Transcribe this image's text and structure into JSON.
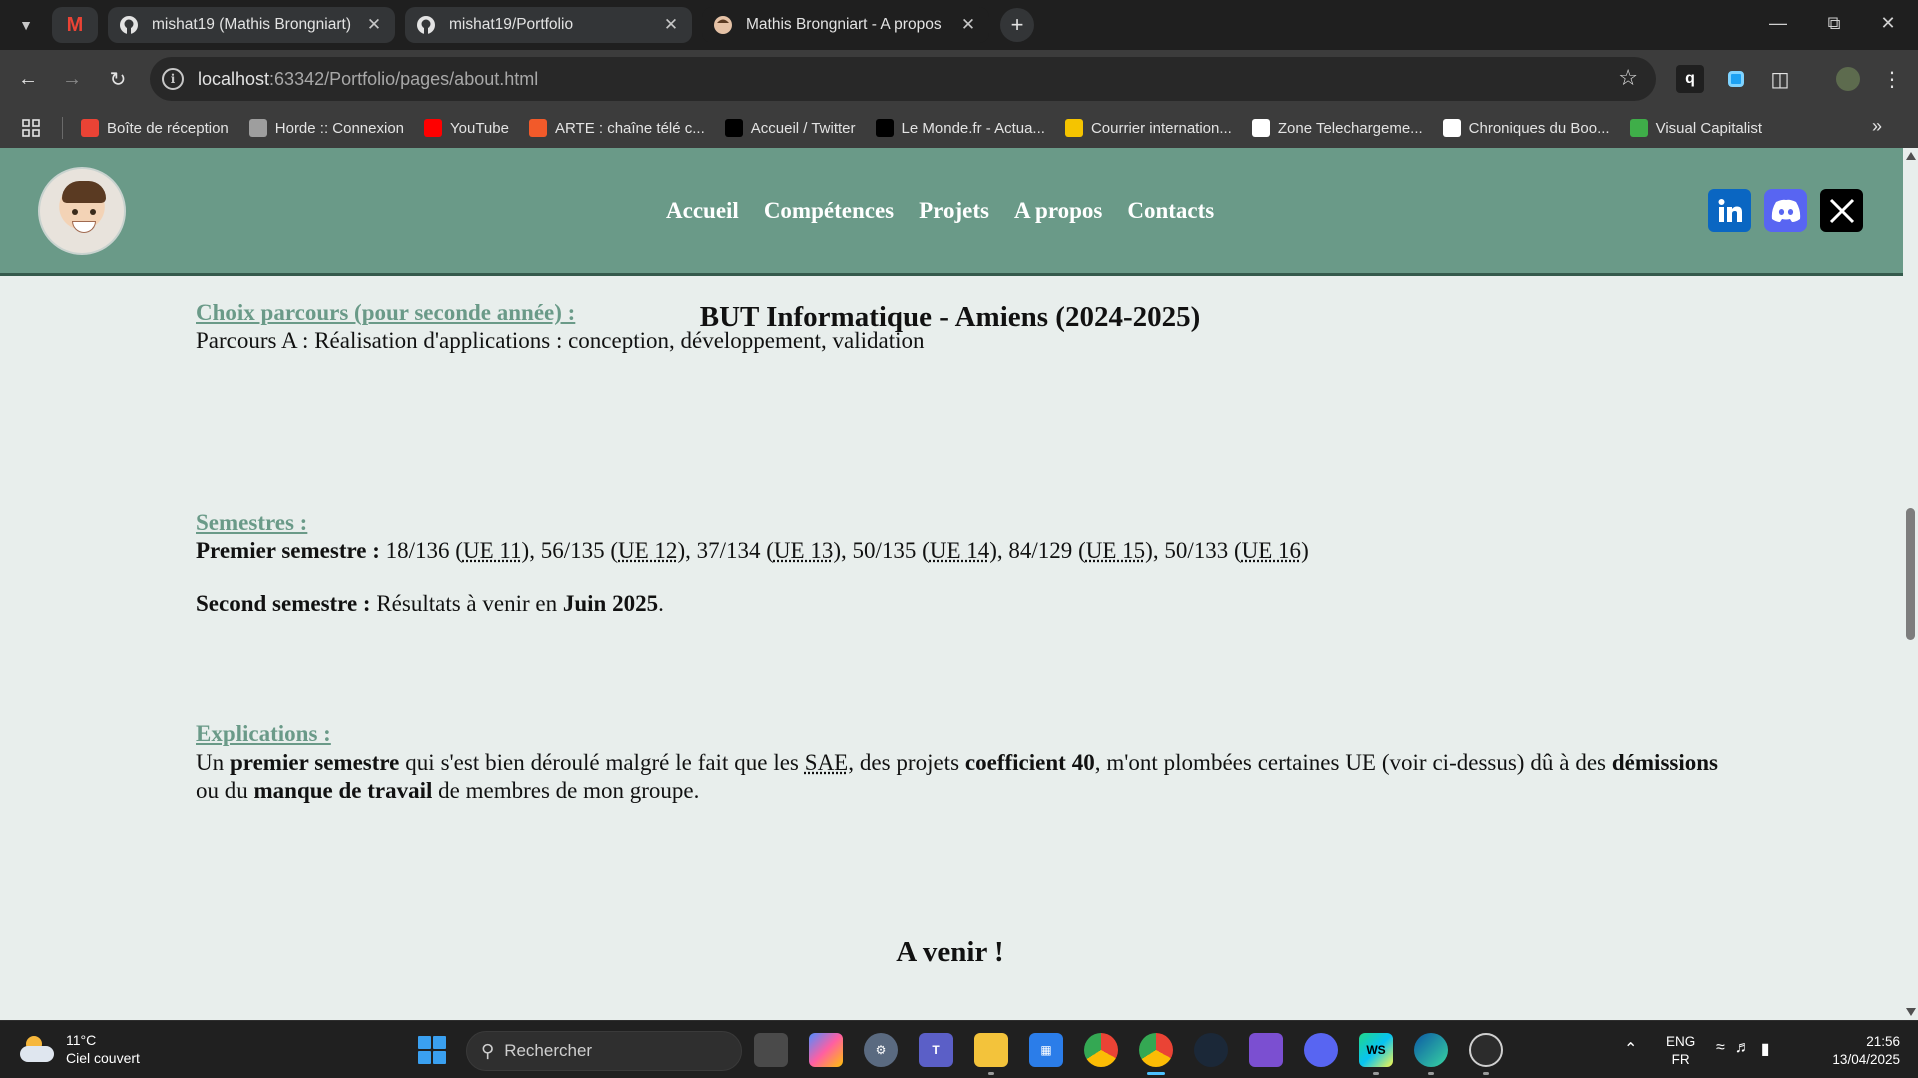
{
  "browser": {
    "tabs": [
      {
        "title": "mishat19 (Mathis Brongniart)",
        "icon": "github-icon"
      },
      {
        "title": "mishat19/Portfolio",
        "icon": "github-icon"
      },
      {
        "title": "Mathis Brongniart - A propos",
        "icon": "avatar-favicon",
        "active": true
      }
    ],
    "url_host": "localhost",
    "url_rest": ":63342/Portfolio/pages/about.html",
    "bookmarks": [
      {
        "label": "Boîte de réception",
        "icon": "gmail-icon",
        "color": "#ea4335"
      },
      {
        "label": "Horde :: Connexion",
        "icon": "horde-icon",
        "color": "#9e9e9e"
      },
      {
        "label": "YouTube",
        "icon": "youtube-icon",
        "color": "#ff0000"
      },
      {
        "label": "ARTE : chaîne télé c...",
        "icon": "arte-icon",
        "color": "#f25a2a"
      },
      {
        "label": "Accueil / Twitter",
        "icon": "x-icon",
        "color": "#000000"
      },
      {
        "label": "Le Monde.fr - Actua...",
        "icon": "lemonde-icon",
        "color": "#000000"
      },
      {
        "label": "Courrier internation...",
        "icon": "courrier-icon",
        "color": "#f5c400"
      },
      {
        "label": "Zone Telechargeme...",
        "icon": "zt-icon",
        "color": "#ffffff"
      },
      {
        "label": "Chroniques du Boo...",
        "icon": "chroniques-icon",
        "color": "#ffffff"
      },
      {
        "label": "Visual Capitalist",
        "icon": "visualcap-icon",
        "color": "#3fae49"
      }
    ]
  },
  "site": {
    "nav": [
      "Accueil",
      "Compétences",
      "Projets",
      "A propos",
      "Contacts"
    ],
    "social": [
      {
        "name": "linkedin-icon",
        "color": "#0a66c2"
      },
      {
        "name": "discord-icon",
        "color": "#5865f2"
      },
      {
        "name": "x-icon",
        "color": "#000000"
      }
    ]
  },
  "content": {
    "heading": "BUT Informatique - Amiens (2024-2025)",
    "parcours_title": "Choix parcours (pour seconde année) :",
    "parcours_text": "Parcours A : Réalisation d'applications : conception, développement, validation",
    "semestres_title": "Semestres :",
    "s1_label": "Premier semestre :",
    "s1_scores": [
      {
        "score": "18/136",
        "ue": "UE 11"
      },
      {
        "score": "56/135",
        "ue": "UE 12"
      },
      {
        "score": "37/134",
        "ue": "UE 13"
      },
      {
        "score": "50/135",
        "ue": "UE 14"
      },
      {
        "score": "84/129",
        "ue": "UE 15"
      },
      {
        "score": "50/133",
        "ue": "UE 16"
      }
    ],
    "s2_label": "Second semestre :",
    "s2_text": "Résultats à venir en",
    "s2_date": "Juin 2025",
    "explications_title": "Explications :",
    "expl": {
      "t1": "Un ",
      "b1": "premier semestre",
      "t2": " qui s'est bien déroulé malgré le fait que les ",
      "abbr": "SAE",
      "t3": ", des projets ",
      "b2": "coefficient 40",
      "t4": ", m'ont plombées certaines UE (voir ci-dessus) dû à des ",
      "b3": "démissions",
      "t5": " ou du ",
      "b4": "manque de travail",
      "t6": " de membres de mon groupe."
    },
    "a_venir": "A venir !"
  },
  "taskbar": {
    "temperature": "11°C",
    "weather": "Ciel couvert",
    "search_placeholder": "Rechercher",
    "lang1": "ENG",
    "lang2": "FR",
    "time": "21:56",
    "date": "13/04/2025"
  }
}
